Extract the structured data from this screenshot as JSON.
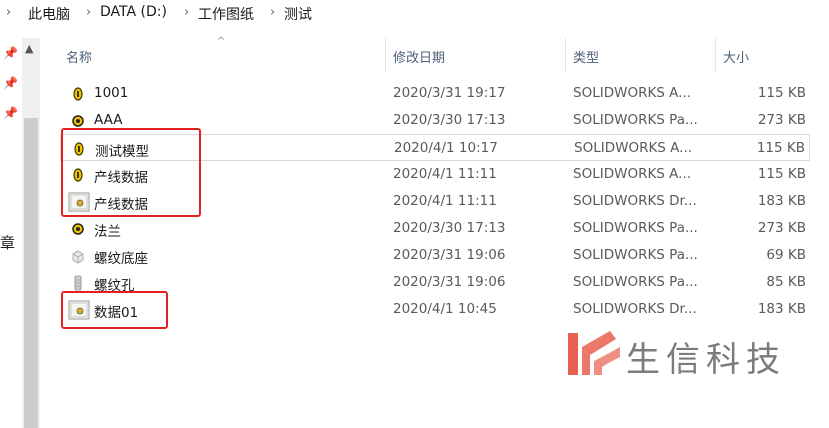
{
  "breadcrumb": {
    "items": [
      "此电脑",
      "DATA (D:)",
      "工作图纸",
      "测试"
    ]
  },
  "nav": {
    "edge_label": "章"
  },
  "columns": {
    "name": "名称",
    "date": "修改日期",
    "type": "类型",
    "size": "大小"
  },
  "files": [
    {
      "name": "1001",
      "date": "2020/3/31 19:17",
      "type": "SOLIDWORKS A...",
      "size": "115 KB",
      "icon": "assembly-icon"
    },
    {
      "name": "AAA",
      "date": "2020/3/30 17:13",
      "type": "SOLIDWORKS Pa...",
      "size": "273 KB",
      "icon": "part-icon"
    },
    {
      "name": "测试模型",
      "date": "2020/4/1 10:17",
      "type": "SOLIDWORKS A...",
      "size": "115 KB",
      "icon": "assembly-icon"
    },
    {
      "name": "产线数据",
      "date": "2020/4/1 11:11",
      "type": "SOLIDWORKS A...",
      "size": "115 KB",
      "icon": "assembly-icon"
    },
    {
      "name": "产线数据",
      "date": "2020/4/1 11:11",
      "type": "SOLIDWORKS Dr...",
      "size": "183 KB",
      "icon": "drawing-icon"
    },
    {
      "name": "法兰",
      "date": "2020/3/30 17:13",
      "type": "SOLIDWORKS Pa...",
      "size": "273 KB",
      "icon": "part-icon"
    },
    {
      "name": "螺纹底座",
      "date": "2020/3/31 19:06",
      "type": "SOLIDWORKS Pa...",
      "size": "69 KB",
      "icon": "part-thumb-icon"
    },
    {
      "name": "螺纹孔",
      "date": "2020/3/31 19:06",
      "type": "SOLIDWORKS Pa...",
      "size": "85 KB",
      "icon": "part-thumb-icon"
    },
    {
      "name": "数据01",
      "date": "2020/4/1 10:45",
      "type": "SOLIDWORKS Dr...",
      "size": "183 KB",
      "icon": "drawing-icon"
    }
  ],
  "watermark": {
    "text": "生信科技"
  },
  "colors": {
    "highlight": "#e52020",
    "header_text": "#4c607a",
    "watermark_accent": "#e8604f"
  }
}
